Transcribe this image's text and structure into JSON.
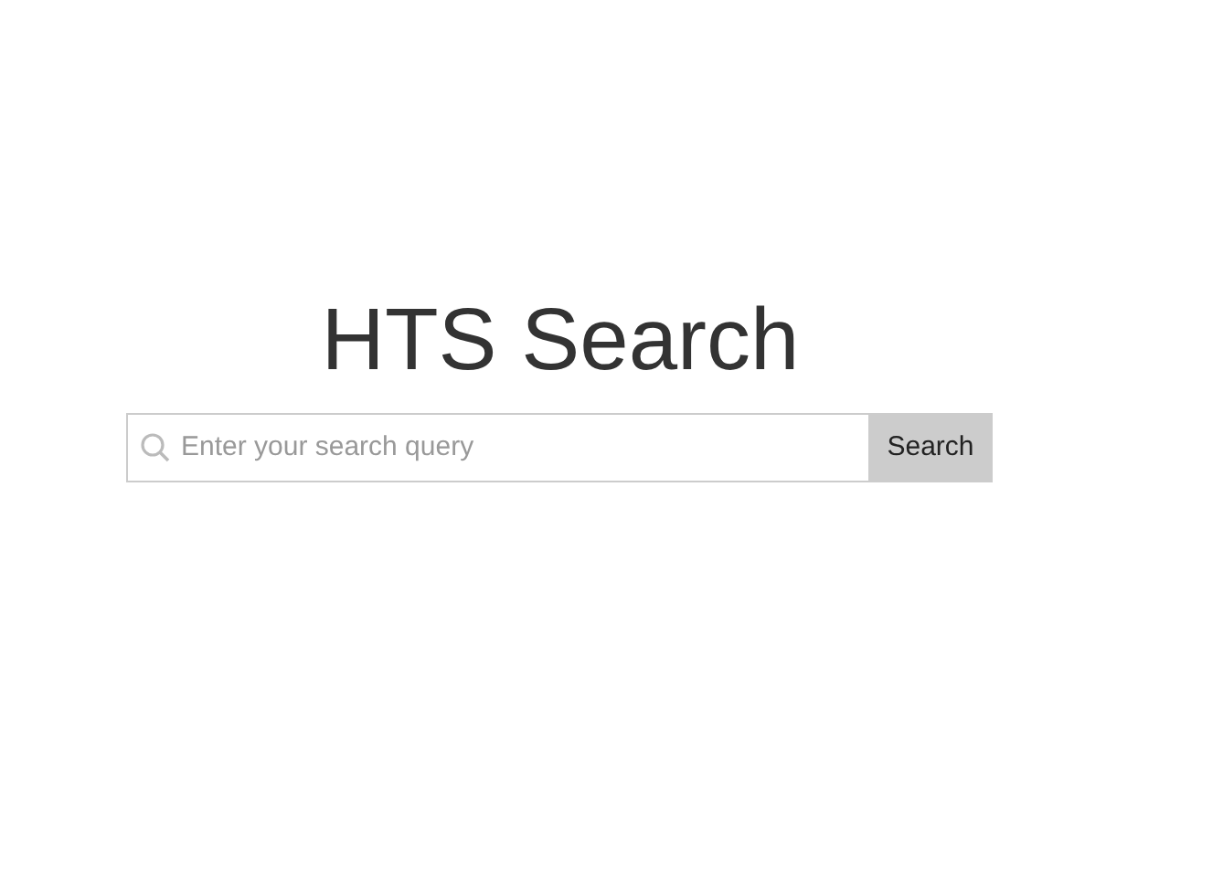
{
  "title": "HTS Search",
  "search": {
    "placeholder": "Enter your search query",
    "button": "Search"
  }
}
